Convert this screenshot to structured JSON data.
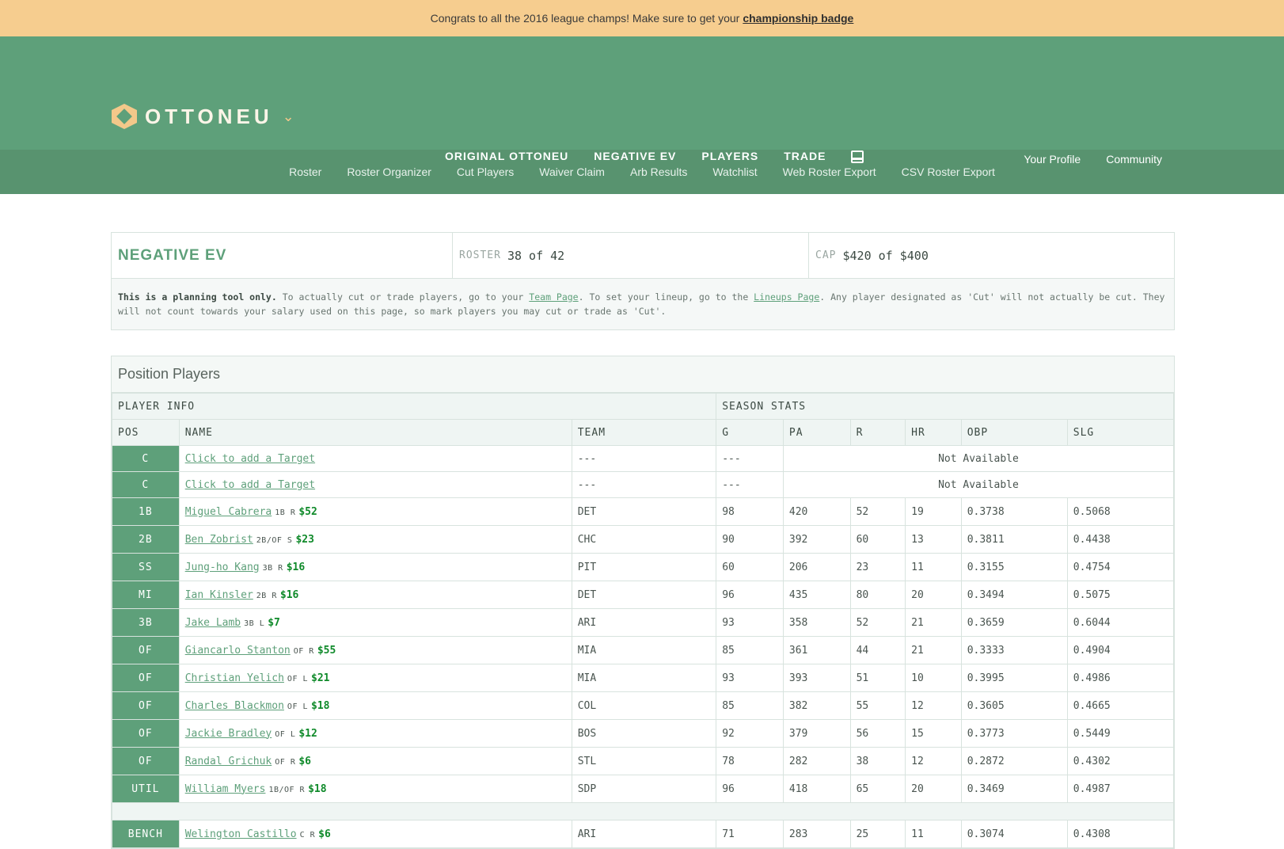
{
  "banner": {
    "text": "Congrats to all the 2016 league champs! Make sure to get your",
    "link": "championship badge"
  },
  "brand": {
    "name": "OTTONEU"
  },
  "nav": {
    "items": [
      "ORIGINAL OTTONEU",
      "NEGATIVE EV",
      "PLAYERS",
      "TRADE"
    ],
    "active": "NEGATIVE EV",
    "user": [
      "Your Profile",
      "Community"
    ]
  },
  "subnav": [
    "Roster",
    "Roster Organizer",
    "Cut Players",
    "Waiver Claim",
    "Arb Results",
    "Watchlist",
    "Web Roster Export",
    "CSV Roster Export"
  ],
  "team": {
    "title": "NEGATIVE EV",
    "roster_label": "ROSTER",
    "roster_value": "38 of 42",
    "cap_label": "CAP",
    "cap_value": "$420 of $400"
  },
  "note": {
    "bold": "This is a planning tool only.",
    "t1": " To actually cut or trade players, go to your ",
    "link1": "Team Page",
    "t2": ". To set your lineup, go to the ",
    "link2": "Lineups Page",
    "t3": ". Any player designated as 'Cut' will not actually be cut. They will not count towards your salary used on this page, so mark players you may cut or trade as 'Cut'."
  },
  "players": {
    "title": "Position Players",
    "group_headers": [
      "PLAYER INFO",
      "SEASON STATS"
    ],
    "columns": [
      "POS",
      "NAME",
      "TEAM",
      "G",
      "PA",
      "R",
      "HR",
      "OBP",
      "SLG"
    ],
    "target_rows": [
      {
        "pos": "C",
        "name": "Click to add a Target",
        "team": "---",
        "g": "---",
        "status": "Not Available"
      },
      {
        "pos": "C",
        "name": "Click to add a Target",
        "team": "---",
        "g": "---",
        "status": "Not Available"
      }
    ],
    "rows": [
      {
        "pos": "1B",
        "name": "Miguel Cabrera",
        "elig": "1B R",
        "salary": "$52",
        "team": "DET",
        "g": "98",
        "pa": "420",
        "r": "52",
        "hr": "19",
        "obp": "0.3738",
        "slg": "0.5068"
      },
      {
        "pos": "2B",
        "name": "Ben Zobrist",
        "elig": "2B/OF S",
        "salary": "$23",
        "team": "CHC",
        "g": "90",
        "pa": "392",
        "r": "60",
        "hr": "13",
        "obp": "0.3811",
        "slg": "0.4438"
      },
      {
        "pos": "SS",
        "name": "Jung-ho Kang",
        "elig": "3B R",
        "salary": "$16",
        "team": "PIT",
        "g": "60",
        "pa": "206",
        "r": "23",
        "hr": "11",
        "obp": "0.3155",
        "slg": "0.4754"
      },
      {
        "pos": "MI",
        "name": "Ian Kinsler",
        "elig": "2B R",
        "salary": "$16",
        "team": "DET",
        "g": "96",
        "pa": "435",
        "r": "80",
        "hr": "20",
        "obp": "0.3494",
        "slg": "0.5075"
      },
      {
        "pos": "3B",
        "name": "Jake Lamb",
        "elig": "3B L",
        "salary": "$7",
        "team": "ARI",
        "g": "93",
        "pa": "358",
        "r": "52",
        "hr": "21",
        "obp": "0.3659",
        "slg": "0.6044"
      },
      {
        "pos": "OF",
        "name": "Giancarlo Stanton",
        "elig": "OF R",
        "salary": "$55",
        "team": "MIA",
        "g": "85",
        "pa": "361",
        "r": "44",
        "hr": "21",
        "obp": "0.3333",
        "slg": "0.4904"
      },
      {
        "pos": "OF",
        "name": "Christian Yelich",
        "elig": "OF L",
        "salary": "$21",
        "team": "MIA",
        "g": "93",
        "pa": "393",
        "r": "51",
        "hr": "10",
        "obp": "0.3995",
        "slg": "0.4986"
      },
      {
        "pos": "OF",
        "name": "Charles Blackmon",
        "elig": "OF L",
        "salary": "$18",
        "team": "COL",
        "g": "85",
        "pa": "382",
        "r": "55",
        "hr": "12",
        "obp": "0.3605",
        "slg": "0.4665"
      },
      {
        "pos": "OF",
        "name": "Jackie Bradley",
        "elig": "OF L",
        "salary": "$12",
        "team": "BOS",
        "g": "92",
        "pa": "379",
        "r": "56",
        "hr": "15",
        "obp": "0.3773",
        "slg": "0.5449"
      },
      {
        "pos": "OF",
        "name": "Randal Grichuk",
        "elig": "OF R",
        "salary": "$6",
        "team": "STL",
        "g": "78",
        "pa": "282",
        "r": "38",
        "hr": "12",
        "obp": "0.2872",
        "slg": "0.4302"
      },
      {
        "pos": "UTIL",
        "name": "William Myers",
        "elig": "1B/OF R",
        "salary": "$18",
        "team": "SDP",
        "g": "96",
        "pa": "418",
        "r": "65",
        "hr": "20",
        "obp": "0.3469",
        "slg": "0.4987"
      }
    ],
    "bench_rows": [
      {
        "pos": "BENCH",
        "name": "Welington Castillo",
        "elig": "C R",
        "salary": "$6",
        "team": "ARI",
        "g": "71",
        "pa": "283",
        "r": "25",
        "hr": "11",
        "obp": "0.3074",
        "slg": "0.4308"
      }
    ]
  }
}
